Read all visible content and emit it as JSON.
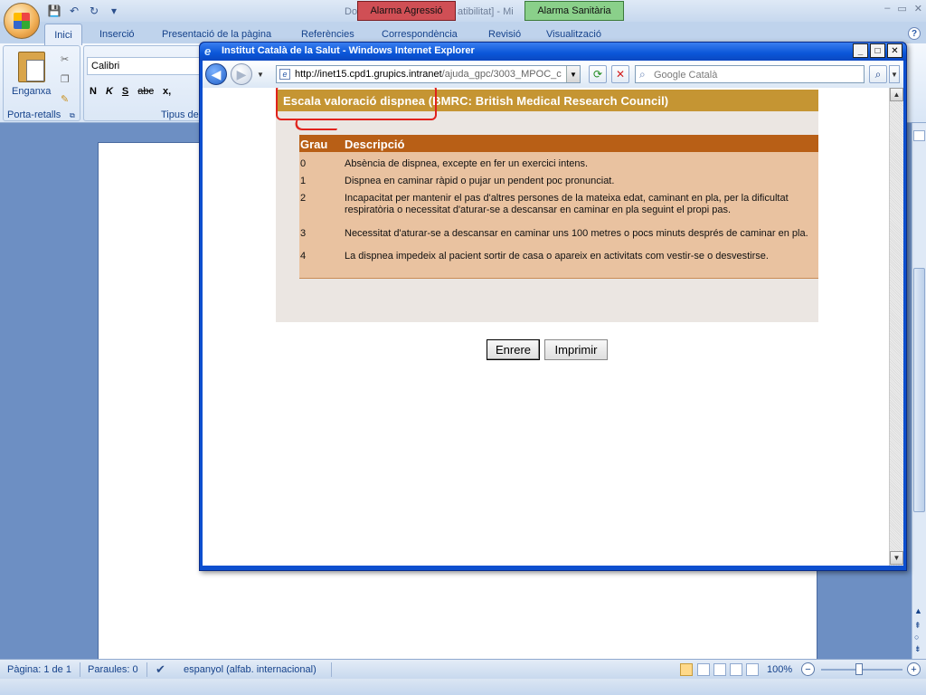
{
  "word": {
    "title_left": "Do",
    "title_mid": "atibilitat] - Mi",
    "quick_access": {
      "save": "💾",
      "undo": "↶",
      "redo": "↻",
      "more": "▾"
    },
    "win_controls": {
      "minimize": "–",
      "restore": "▭",
      "close": "✕"
    },
    "help": "?",
    "tabs": [
      "Inici",
      "Inserció",
      "Presentació de la pàgina",
      "Referències",
      "Correspondència",
      "Revisió",
      "Visualització"
    ],
    "ribbon": {
      "paste_label": "Enganxa",
      "clipboard_label": "Porta-retalls",
      "font_name": "Calibri",
      "font_group_label": "Tipus de",
      "font_buttons": {
        "bold": "N",
        "italic": "K",
        "underline": "S",
        "strike": "abc",
        "sub": "x,"
      }
    },
    "statusbar": {
      "page": "Pàgina: 1 de 1",
      "words": "Paraules: 0",
      "language": "espanyol (alfab. internacional)",
      "zoom": "100%"
    }
  },
  "alarms": {
    "aggression": "Alarma Agressió",
    "health": "Alarma Sanitària",
    "aggression_color": "#d04f55",
    "health_color": "#8ad08a"
  },
  "ie": {
    "title": "Institut Català de la Salut - Windows Internet Explorer",
    "address_host": "http://inet15.cpd1.grupics.intranet",
    "address_path": "/ajuda_gpc/3003_MPOC_c",
    "search_placeholder": "Google Català",
    "buttons": {
      "back": "◀",
      "forward": "▶",
      "refresh": "⟳",
      "stop": "✕",
      "search": "⌕"
    }
  },
  "page": {
    "scale_title": "Escala valoració dispnea (BMRC: British Medical Research Council)",
    "columns": [
      "Grau",
      "Descripció"
    ],
    "grades": [
      {
        "grade": "0",
        "description": "Absència de dispnea, excepte en fer un exercici intens."
      },
      {
        "grade": "1",
        "description": "Dispnea en caminar ràpid o pujar un pendent poc pronunciat."
      },
      {
        "grade": "2",
        "description": "Incapacitat per mantenir el pas d'altres persones de la mateixa edat, caminant en pla, per la dificultat respiratòria o necessitat d'aturar-se a descansar en caminar en pla seguint el propi pas."
      },
      {
        "grade": "3",
        "description": "Necessitat d'aturar-se a descansar en caminar uns 100 metres o pocs minuts després de caminar en pla."
      },
      {
        "grade": "4",
        "description": "La dispnea impedeix al pacient sortir de casa o apareix en activitats com vestir-se o desvestirse."
      }
    ],
    "buttons": {
      "back": "Enrere",
      "print": "Imprimir"
    },
    "colors": {
      "header": "#c59533",
      "table_header": "#b85f16",
      "table_body": "#e9c2a0",
      "highlight": "#e0231c"
    }
  }
}
